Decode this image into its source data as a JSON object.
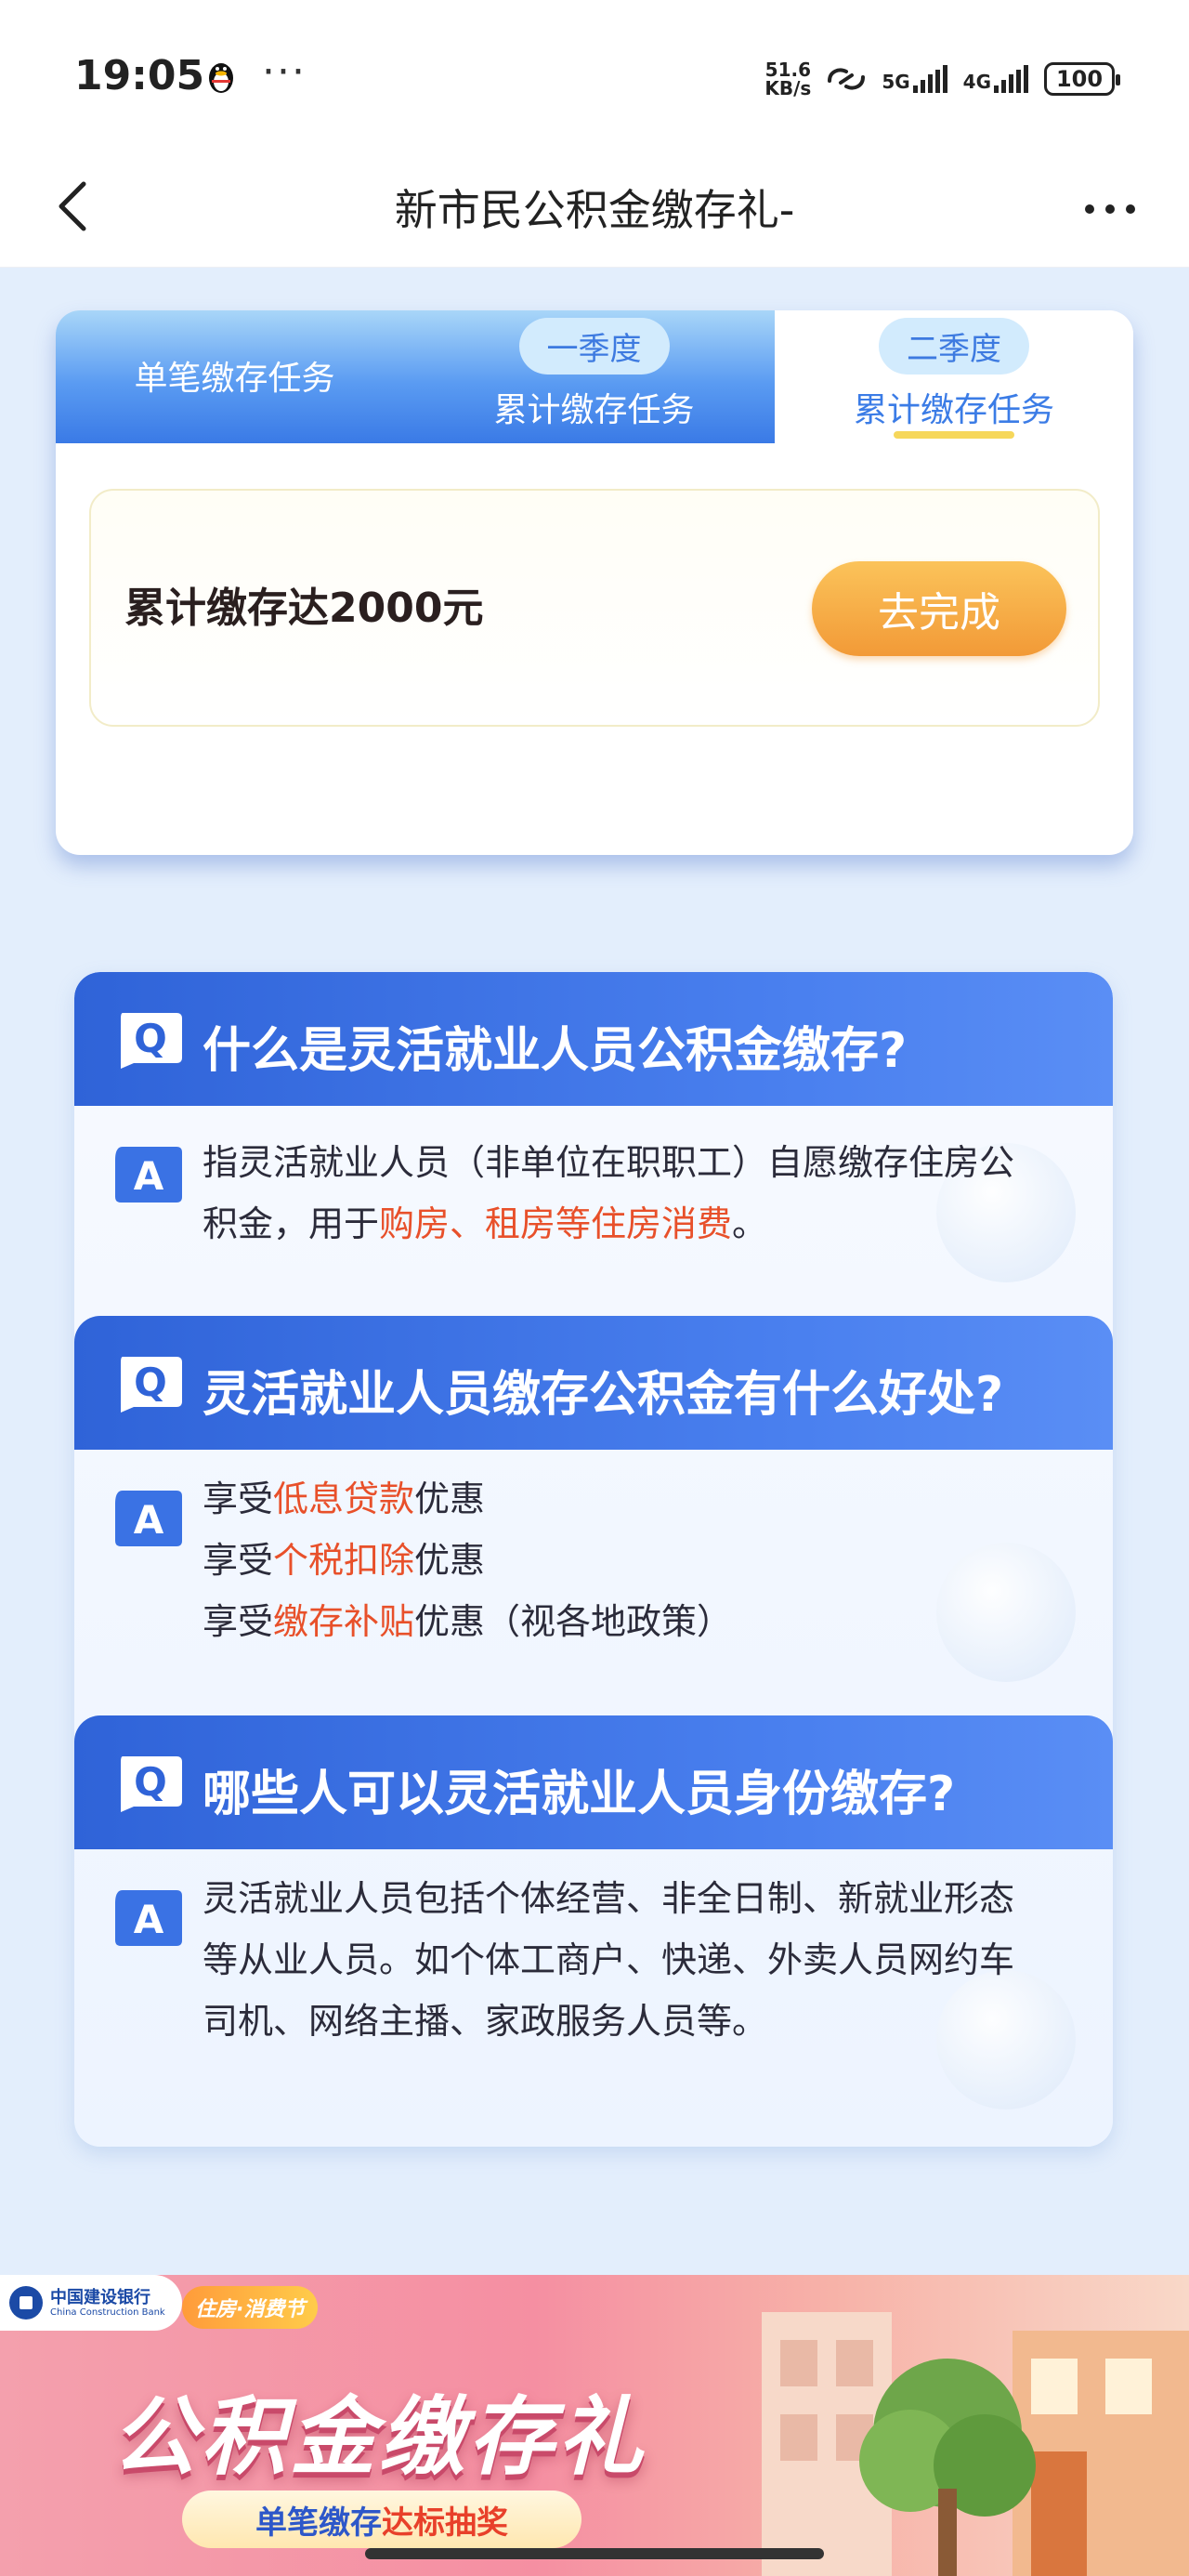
{
  "status_bar": {
    "time": "19:05",
    "dots": "···",
    "net_speed_value": "51.6",
    "net_speed_unit": "KB/s",
    "sig1_label": "5G",
    "sig2_label": "4G",
    "battery": "100"
  },
  "header": {
    "title": "新市民公积金缴存礼-"
  },
  "tabs": [
    {
      "label": "单笔缴存任务"
    },
    {
      "pill": "一季度",
      "label": "累计缴存任务"
    },
    {
      "pill": "二季度",
      "label": "累计缴存任务",
      "active": true
    }
  ],
  "task": {
    "text": "累计缴存达2000元",
    "button": "去完成"
  },
  "faq": [
    {
      "question": "什么是灵活就业人员公积金缴存?",
      "answer_parts": [
        "指灵活就业人员（非单位在职职工）自愿缴存住房公积金，用于",
        "购房、租房等住房消费",
        "。"
      ]
    },
    {
      "question": "灵活就业人员缴存公积金有什么好处?",
      "lines": [
        [
          "享受",
          "低息贷款",
          "优惠"
        ],
        [
          "享受",
          "个税扣除",
          "优惠"
        ],
        [
          "享受",
          "缴存补贴",
          "优惠（视各地政策）"
        ]
      ]
    },
    {
      "question": "哪些人可以灵活就业人员身份缴存?",
      "answer": "灵活就业人员包括个体经营、非全日制、新就业形态等从业人员。如个体工商户、快递、外卖人员网约车司机、网络主播、家政服务人员等。"
    }
  ],
  "badges": {
    "q": "Q",
    "a": "A"
  },
  "banner": {
    "bank_name": "中国建设银行",
    "bank_name_en": "China Construction Bank",
    "tag": "住房·消费节",
    "title": "公积金缴存礼",
    "sub_part1": "单笔缴存",
    "sub_part2": "达标抽奖"
  },
  "colors": {
    "accent_blue": "#3a72e4",
    "highlight": "#e8502a",
    "button_orange": "#f29a37"
  }
}
